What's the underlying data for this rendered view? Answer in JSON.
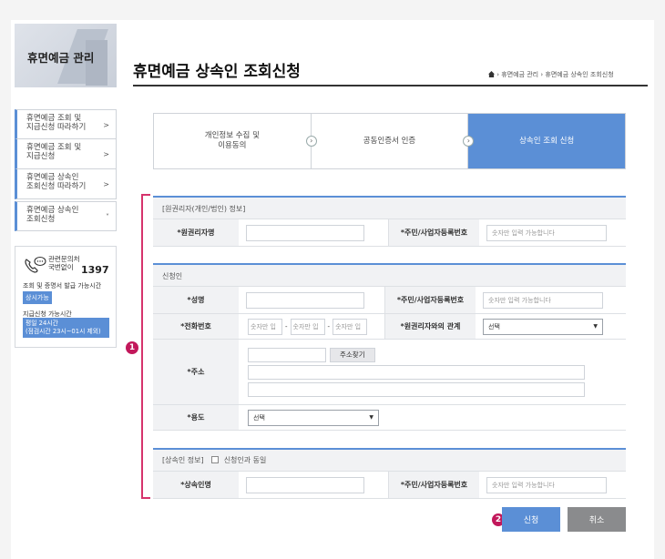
{
  "sidebar": {
    "title": "휴면예금 관리",
    "items": [
      {
        "label": "휴면예금 조회 및\n지급신청 따라하기",
        "chev": ">"
      },
      {
        "label": "휴면예금 조회 및\n지급신청",
        "chev": ">"
      },
      {
        "label": "휴면예금 상속인\n조회신청 따라하기",
        "chev": ">"
      },
      {
        "label": "휴면예금 상속인\n조회신청",
        "chev": "˅"
      }
    ],
    "contact": {
      "line1": "관련문의처",
      "line2": "국번없이",
      "number": "1397",
      "hours_label": "조회 및 증명서 발급 가능시간",
      "hours_badge": "상시가능",
      "apply_label": "지급신청 가능시간",
      "apply_badge_1": "평일 24시간",
      "apply_badge_2": "(점검시간 23시~01시 제외)"
    }
  },
  "header": {
    "title": "휴면예금 상속인 조회신청",
    "breadcrumb": "›  휴면예금 관리  ›  휴면예금 상속인 조회신청"
  },
  "steps": [
    {
      "label": "개인정보 수집 및\n이용동의",
      "active": false
    },
    {
      "label": "공동인증서 인증",
      "active": false
    },
    {
      "label": "상속인 조회 신청",
      "active": true
    }
  ],
  "markers": {
    "one": "1",
    "two": "2"
  },
  "section1": {
    "title": "[원권리자(개인/법인) 정보]",
    "name_label": "*원권리자명",
    "id_label": "*주민/사업자등록번호",
    "id_placeholder": "숫자만 입력 가능합니다"
  },
  "section2": {
    "title": "신청인",
    "name_label": "*성명",
    "id_label": "*주민/사업자등록번호",
    "id_placeholder": "숫자만 입력 가능합니다",
    "phone_label": "*전화번호",
    "phone_placeholder": "숫자만 입",
    "relation_label": "*원권리자와의 관계",
    "relation_value": "선택",
    "address_label": "*주소",
    "address_button": "주소찾기",
    "usage_label": "*용도",
    "usage_value": "선택"
  },
  "section3": {
    "title": "[상속인 정보]",
    "same_label": "신청인과 동일",
    "name_label": "*상속인명",
    "id_label": "*주민/사업자등록번호",
    "id_placeholder": "숫자만 입력 가능합니다"
  },
  "buttons": {
    "apply": "신청",
    "cancel": "취소"
  },
  "colors": {
    "accent": "#5b8fd6",
    "marker": "#c2185b"
  }
}
